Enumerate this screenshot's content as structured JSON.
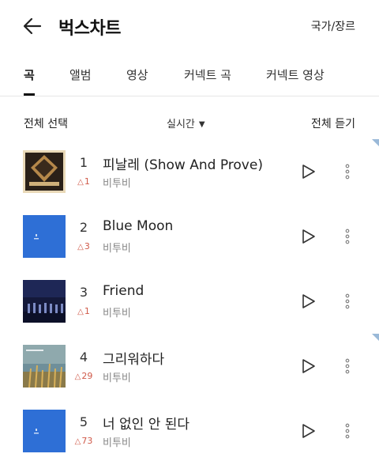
{
  "header": {
    "title": "벅스차트",
    "region_link": "국가/장르"
  },
  "tabs": [
    {
      "label": "곡",
      "active": true
    },
    {
      "label": "앨범",
      "active": false
    },
    {
      "label": "영상",
      "active": false
    },
    {
      "label": "커넥트 곡",
      "active": false
    },
    {
      "label": "커넥트 영상",
      "active": false
    }
  ],
  "toolbar": {
    "select_all": "전체 선택",
    "sort": "실시간",
    "play_all": "전체 듣기"
  },
  "tracks": [
    {
      "rank": "1",
      "change": "1",
      "title": "피날레 (Show And Prove)",
      "artist": "비투비",
      "cover": "album-cover-finale"
    },
    {
      "rank": "2",
      "change": "3",
      "title": "Blue Moon",
      "artist": "비투비",
      "cover": "album-cover-blue"
    },
    {
      "rank": "3",
      "change": "1",
      "title": "Friend",
      "artist": "비투비",
      "cover": "album-cover-night"
    },
    {
      "rank": "4",
      "change": "29",
      "title": "그리워하다",
      "artist": "비투비",
      "cover": "album-cover-field"
    },
    {
      "rank": "5",
      "change": "73",
      "title": "너 없인 안 된다",
      "artist": "비투비",
      "cover": "album-cover-blue"
    }
  ],
  "colors": {
    "accent": "#111111",
    "rank_up": "#d05a4a",
    "secondary_text": "#888888",
    "divider": "#e6e6e6"
  }
}
